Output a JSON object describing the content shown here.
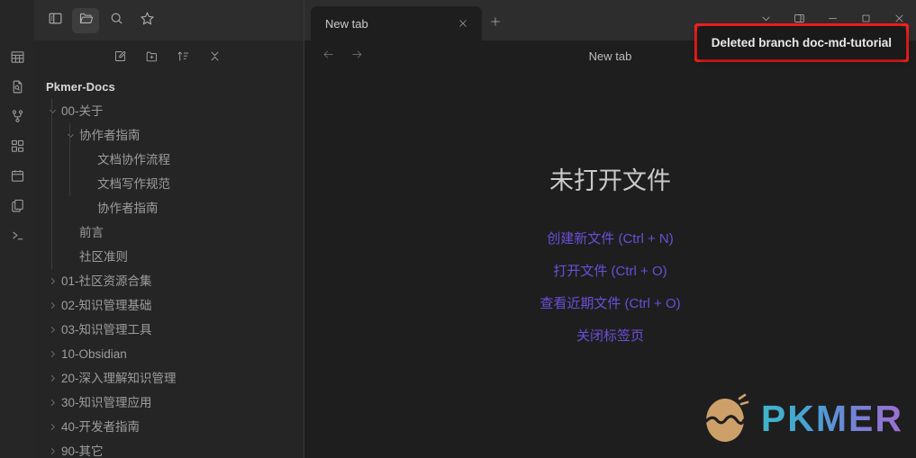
{
  "window": {
    "controls": [
      {
        "name": "chevron-down-icon",
        "label": "More"
      },
      {
        "name": "right-sidebar-toggle-icon",
        "label": "Toggle right sidebar"
      },
      {
        "name": "minimize-icon",
        "label": "Minimize"
      },
      {
        "name": "maximize-icon",
        "label": "Maximize"
      },
      {
        "name": "close-icon",
        "label": "Close"
      }
    ]
  },
  "rail": {
    "top_icon": "sidebar-toggle-icon",
    "items": [
      {
        "icon": "table-icon",
        "label": "Table"
      },
      {
        "icon": "document-search-icon",
        "label": "Search in files"
      },
      {
        "icon": "git-branch-icon",
        "label": "Source control"
      },
      {
        "icon": "apps-grid-icon",
        "label": "Plugins"
      },
      {
        "icon": "calendar-icon",
        "label": "Calendar"
      },
      {
        "icon": "copy-files-icon",
        "label": "Templates"
      },
      {
        "icon": "terminal-icon",
        "label": "Terminal"
      }
    ]
  },
  "explorer": {
    "topbar": [
      {
        "icon": "sidebar-toggle-icon",
        "label": "Toggle left sidebar",
        "active": false
      },
      {
        "icon": "folder-open-icon",
        "label": "Files",
        "active": true
      },
      {
        "icon": "search-icon",
        "label": "Search",
        "active": false
      },
      {
        "icon": "star-icon",
        "label": "Bookmarks",
        "active": false
      }
    ],
    "tools": [
      {
        "icon": "new-note-icon",
        "label": "New note"
      },
      {
        "icon": "new-folder-icon",
        "label": "New folder"
      },
      {
        "icon": "sort-icon",
        "label": "Change sort order"
      },
      {
        "icon": "collapse-all-icon",
        "label": "Collapse all"
      }
    ],
    "vault_title": "Pkmer-Docs",
    "tree": [
      {
        "label": "00-关于",
        "depth": 0,
        "type": "folder",
        "expanded": true
      },
      {
        "label": "协作者指南",
        "depth": 1,
        "type": "folder",
        "expanded": true
      },
      {
        "label": "文档协作流程",
        "depth": 2,
        "type": "file"
      },
      {
        "label": "文档写作规范",
        "depth": 2,
        "type": "file"
      },
      {
        "label": "协作者指南",
        "depth": 2,
        "type": "file"
      },
      {
        "label": "前言",
        "depth": 1,
        "type": "file"
      },
      {
        "label": "社区准则",
        "depth": 1,
        "type": "file"
      },
      {
        "label": "01-社区资源合集",
        "depth": 0,
        "type": "folder",
        "expanded": false
      },
      {
        "label": "02-知识管理基础",
        "depth": 0,
        "type": "folder",
        "expanded": false
      },
      {
        "label": "03-知识管理工具",
        "depth": 0,
        "type": "folder",
        "expanded": false
      },
      {
        "label": "10-Obsidian",
        "depth": 0,
        "type": "folder",
        "expanded": false
      },
      {
        "label": "20-深入理解知识管理",
        "depth": 0,
        "type": "folder",
        "expanded": false
      },
      {
        "label": "30-知识管理应用",
        "depth": 0,
        "type": "folder",
        "expanded": false
      },
      {
        "label": "40-开发者指南",
        "depth": 0,
        "type": "folder",
        "expanded": false
      },
      {
        "label": "90-其它",
        "depth": 0,
        "type": "folder",
        "expanded": false
      }
    ]
  },
  "tabs": {
    "items": [
      {
        "title": "New tab",
        "active": true
      }
    ],
    "new_tab_icon": "plus-icon",
    "close_icon": "close-icon"
  },
  "view": {
    "back_icon": "arrow-left-icon",
    "forward_icon": "arrow-right-icon",
    "title": "New tab"
  },
  "empty_state": {
    "heading": "未打开文件",
    "links": [
      "创建新文件 (Ctrl + N)",
      "打开文件 (Ctrl + O)",
      "查看近期文件 (Ctrl + O)",
      "关闭标签页"
    ]
  },
  "notification": {
    "message": "Deleted branch doc-md-tutorial",
    "highlight_color": "#ff1f1f"
  },
  "watermark": {
    "text": "PKMER",
    "logo_icon": "pkmer-egg-logo-icon"
  },
  "colors": {
    "accent_link": "#6b4fd8",
    "background": "#1e1e1e",
    "sidebar_bg": "#252525",
    "rail_bg": "#262626",
    "titlebar_bg": "#2d2d2d"
  }
}
